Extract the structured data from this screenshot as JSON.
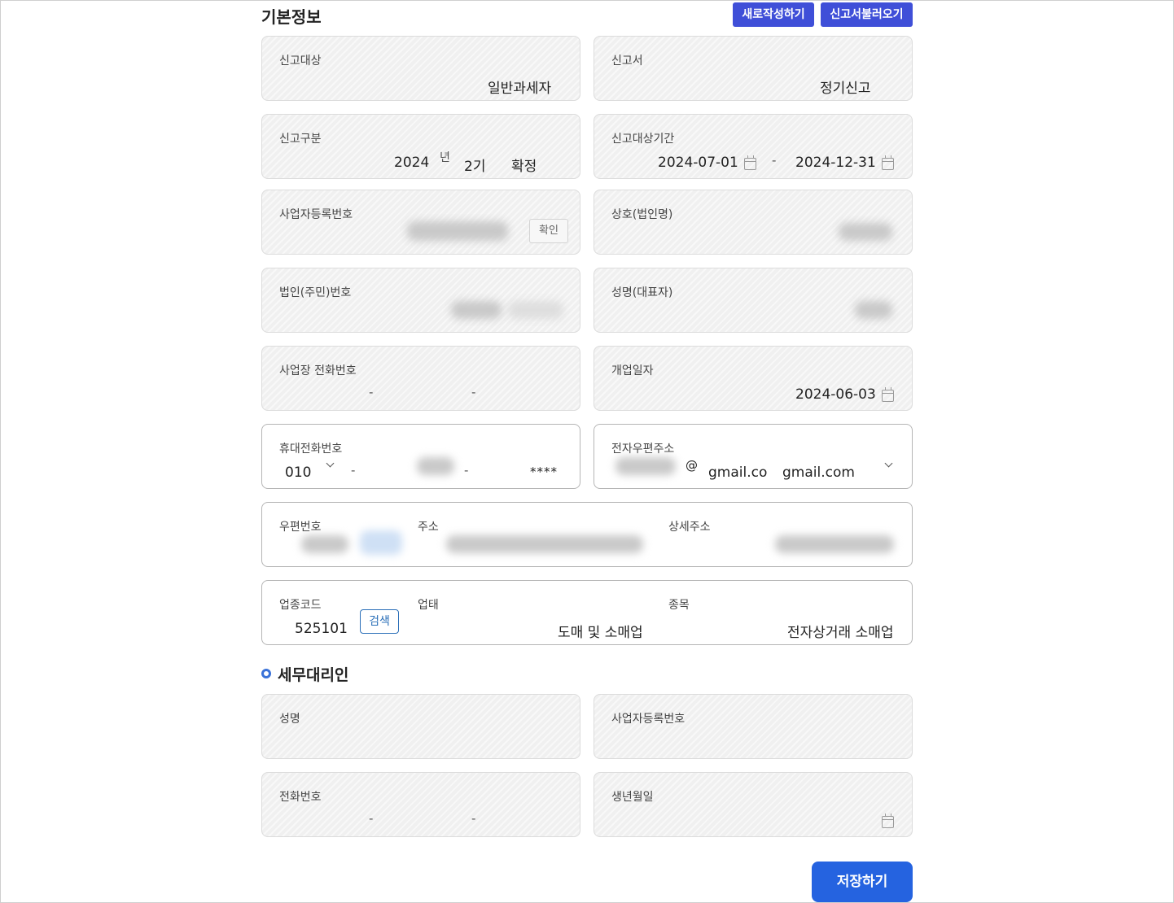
{
  "basic": {
    "title": "기본정보",
    "new_button": "새로작성하기",
    "load_button": "신고서불러오기"
  },
  "fields": {
    "report_target": {
      "label": "신고대상",
      "value": "일반과세자"
    },
    "report_type": {
      "label": "신고서",
      "value": "정기신고"
    },
    "report_category": {
      "label": "신고구분",
      "year": "2024",
      "year_unit": "년",
      "period": "2기",
      "status": "확정"
    },
    "report_period": {
      "label": "신고대상기간",
      "start": "2024-07-01",
      "separator": "-",
      "end": "2024-12-31"
    },
    "business_reg_no": {
      "label": "사업자등록번호",
      "confirm": "확인"
    },
    "company_name": {
      "label": "상호(법인명)"
    },
    "corp_id_no": {
      "label": "법인(주민)번호"
    },
    "representative": {
      "label": "성명(대표자)"
    },
    "business_phone": {
      "label": "사업장 전화번호",
      "sep1": "-",
      "sep2": "-"
    },
    "open_date": {
      "label": "개업일자",
      "value": "2024-06-03"
    },
    "mobile": {
      "label": "휴대전화번호",
      "prefix": "010",
      "sep1": "-",
      "sep2": "-",
      "last": "****"
    },
    "email": {
      "label": "전자우편주소",
      "at": "@",
      "domain_input": "gmail.co",
      "domain_select": "gmail.com"
    },
    "address": {
      "zip_label": "우편번호",
      "addr_label": "주소",
      "detail_label": "상세주소"
    },
    "industry": {
      "code_label": "업종코드",
      "code": "525101",
      "search": "검색",
      "type_label": "업태",
      "type_value": "도매 및 소매업",
      "item_label": "종목",
      "item_value": "전자상거래 소매업"
    }
  },
  "agent": {
    "title": "세무대리인",
    "name_label": "성명",
    "reg_label": "사업자등록번호",
    "phone_label": "전화번호",
    "phone_sep1": "-",
    "phone_sep2": "-",
    "birth_label": "생년월일"
  },
  "save_button": "저장하기",
  "colors": {
    "primary": "#3f4fd8",
    "save": "#2563e0",
    "search": "#2a6fb8",
    "marker": "#3a72d8"
  },
  "icons": {
    "calendar": "calendar-icon",
    "chevron": "chevron-down-icon",
    "section_marker": "circle-marker-icon"
  }
}
